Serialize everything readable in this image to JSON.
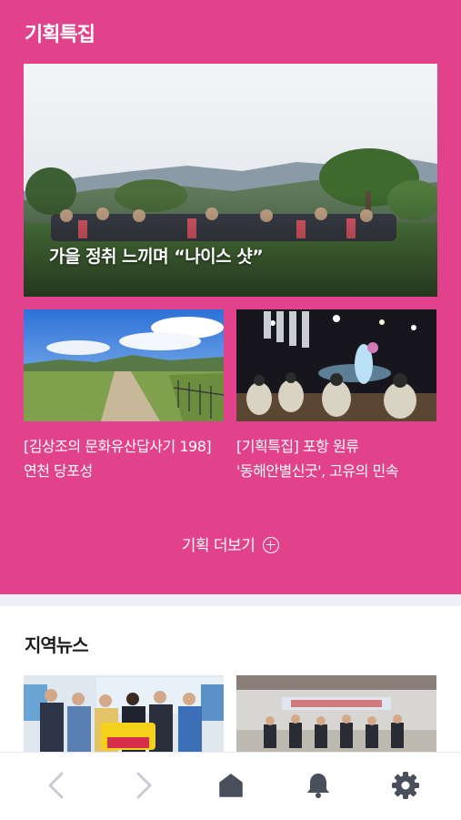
{
  "feature": {
    "title": "기획특집",
    "hero": {
      "caption": "가을 정취 느끼며 “나이스 샷”"
    },
    "cards": [
      {
        "title": "[김상조의 문화유산답사기 198] 연천 당포성"
      },
      {
        "title": "[기획특집] 포항 원류 '동해안별신굿', 고유의 민속"
      }
    ],
    "more_label": "기획 더보기",
    "colors": {
      "background": "#e2428b"
    }
  },
  "local_news": {
    "title": "지역뉴스"
  },
  "navbar": {
    "items": [
      {
        "icon": "chevron-left-icon",
        "enabled": false
      },
      {
        "icon": "chevron-right-icon",
        "enabled": false
      },
      {
        "icon": "home-icon",
        "enabled": true
      },
      {
        "icon": "bell-icon",
        "enabled": true
      },
      {
        "icon": "gear-icon",
        "enabled": true
      }
    ],
    "colors": {
      "active": "#4a4f5c",
      "disabled": "#c9ccd4"
    }
  }
}
